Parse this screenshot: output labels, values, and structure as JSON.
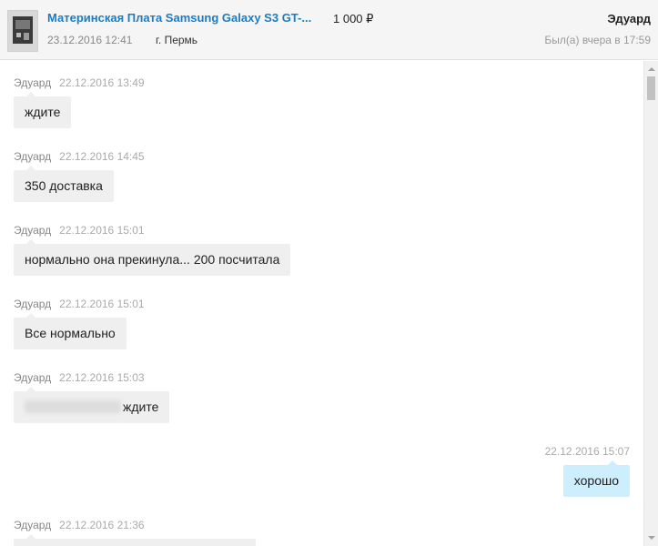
{
  "header": {
    "item_title": "Материнская Плата Samsung Galaxy S3 GT-...",
    "price": "1 000 ₽",
    "item_date": "23.12.2016 12:41",
    "city": "г. Пермь",
    "user_name": "Эдуард",
    "last_seen": "Был(а) вчера в 17:59"
  },
  "messages": [
    {
      "author": "Эдуард",
      "time": "22.12.2016 13:49",
      "text": "ждите",
      "direction": "in"
    },
    {
      "author": "Эдуард",
      "time": "22.12.2016 14:45",
      "text": "350 доставка",
      "direction": "in"
    },
    {
      "author": "Эдуард",
      "time": "22.12.2016 15:01",
      "text": "нормально она прекинула... 200 посчитала",
      "direction": "in"
    },
    {
      "author": "Эдуард",
      "time": "22.12.2016 15:01",
      "text": "Все нормально",
      "direction": "in"
    },
    {
      "author": "Эдуард",
      "time": "22.12.2016 15:03",
      "text": "ждите",
      "direction": "in",
      "redacted_prefix": true
    },
    {
      "author": "",
      "time": "22.12.2016 15:07",
      "text": "хорошо",
      "direction": "out"
    },
    {
      "author": "Эдуард",
      "time": "22.12.2016 21:36",
      "text": "",
      "direction": "in"
    }
  ],
  "colors": {
    "link": "#1a7dc4",
    "incoming_bubble": "#efefef",
    "outgoing_bubble": "#cdeefc"
  }
}
